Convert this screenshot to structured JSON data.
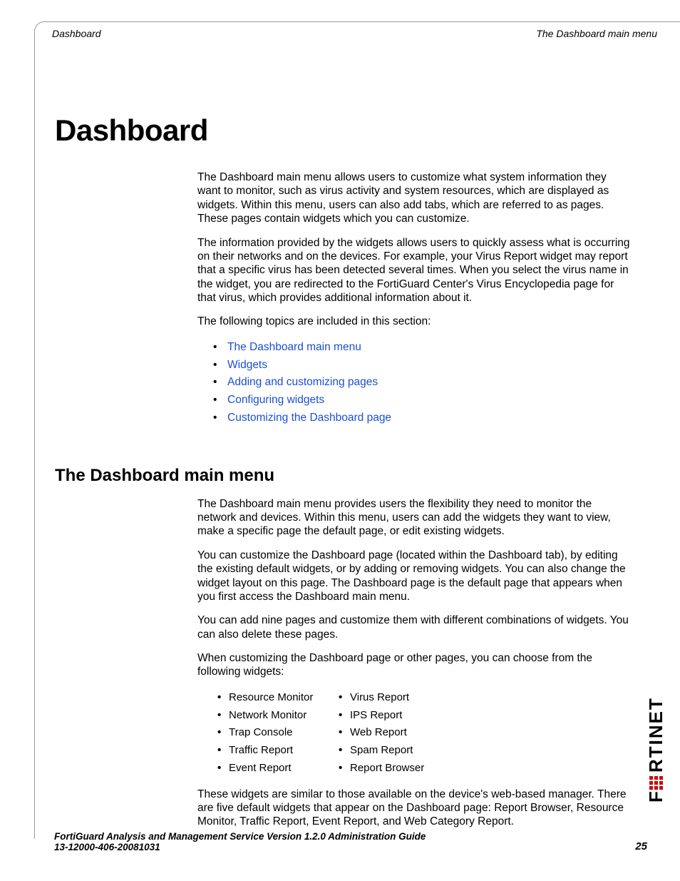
{
  "runhead": {
    "left": "Dashboard",
    "right": "The Dashboard main menu"
  },
  "title": "Dashboard",
  "intro1": "The Dashboard main menu allows users to customize what system information they want to monitor, such as virus activity and system resources, which are displayed as widgets. Within this menu, users can also add tabs, which are referred to as pages. These pages contain widgets which you can customize.",
  "intro2": "The information provided by the widgets allows users to quickly assess what is occurring on their networks and on the devices. For example, your Virus Report widget may report that a specific virus has been detected several times. When you select the virus name in the widget, you are redirected to the FortiGuard Center's Virus Encyclopedia page for that virus, which provides additional information about it.",
  "intro3": "The following topics are included in this section:",
  "topics": [
    "The Dashboard main menu",
    "Widgets",
    "Adding and customizing pages",
    "Configuring widgets",
    "Customizing the Dashboard page"
  ],
  "h2": "The Dashboard main menu",
  "sec1": "The Dashboard main menu provides users the flexibility they need to monitor the network and devices. Within this menu, users can add the widgets they want to view, make a specific page the default page, or edit existing widgets.",
  "sec2": "You can customize the Dashboard page (located within the Dashboard tab), by editing the existing default widgets, or by adding or removing widgets. You can also change the widget layout on this page. The Dashboard page is the default page that appears when you first access the Dashboard main menu.",
  "sec3": "You can add nine pages and customize them with different combinations of widgets. You can also delete these pages.",
  "sec4": "When customizing the Dashboard page or other pages, you can choose from the following widgets:",
  "widgets_col1": [
    "Resource Monitor",
    "Network Monitor",
    "Trap Console",
    "Traffic Report",
    "Event Report"
  ],
  "widgets_col2": [
    "Virus Report",
    "IPS Report",
    "Web Report",
    "Spam Report",
    "Report Browser"
  ],
  "sec5": "These widgets are similar to those available on the device's web-based manager. There are five default widgets that appear on the Dashboard page: Report Browser, Resource Monitor, Traffic Report, Event Report, and Web Category Report.",
  "footer": {
    "line1": "FortiGuard Analysis and Management Service Version 1.2.0 Administration Guide",
    "line2": "13-12000-406-20081031",
    "page": "25"
  }
}
